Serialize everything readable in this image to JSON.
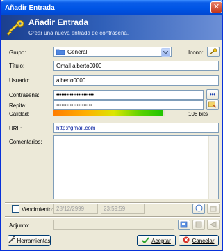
{
  "window": {
    "title": "Añadir Entrada",
    "close_label": "✕"
  },
  "banner": {
    "title": "Añadir Entrada",
    "subtitle": "Crear una nueva entrada de contraseña."
  },
  "labels": {
    "group": "Grupo:",
    "icon": "Icono:",
    "title": "Título:",
    "user": "Usuario:",
    "password": "Contraseña:",
    "repeat": "Repita:",
    "quality": "Calidad:",
    "url": "URL:",
    "comments": "Comentarios:",
    "expiry": "Vencimiento:",
    "attachment": "Adjunto:"
  },
  "fields": {
    "group": "General",
    "title": "Gmail alberto0000",
    "user": "alberto0000",
    "password": "••••••••••••••••••••••",
    "repeat": "•••••••••••••••••••••",
    "url": "http://gmail.com",
    "comments": "",
    "expiry_date": "28/12/2999",
    "expiry_time": "23:59:59",
    "attachment": ""
  },
  "quality": {
    "fraction": 0.99,
    "text": "108 bits"
  },
  "expiry_checked": false,
  "buttons": {
    "reveal_label": "•••",
    "tools_label": "Herramientas",
    "accept_label": "Aceptar",
    "cancel_label": "Cancelar"
  },
  "colors": {
    "title_bar": "#0055e5",
    "banner": "#2f5fb8",
    "accent": "#0831d9"
  }
}
